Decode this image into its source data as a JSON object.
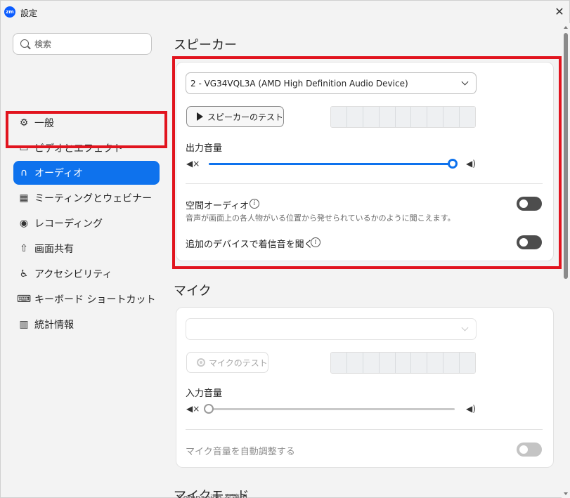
{
  "window": {
    "logo_text": "zm",
    "title": "設定",
    "close_glyph": "✕"
  },
  "sidebar": {
    "search_placeholder": "検索",
    "items": [
      {
        "label": "一般",
        "icon": "gear-icon",
        "glyph": "⚙"
      },
      {
        "label": "ビデオとエフェクト",
        "icon": "video-camera-icon",
        "glyph": "▭"
      },
      {
        "label": "オーディオ",
        "icon": "headphones-icon",
        "glyph": "∩",
        "active": true
      },
      {
        "label": "ミーティングとウェビナー",
        "icon": "meeting-icon",
        "glyph": "▦"
      },
      {
        "label": "レコーディング",
        "icon": "record-icon",
        "glyph": "◉"
      },
      {
        "label": "画面共有",
        "icon": "screen-share-icon",
        "glyph": "⇧"
      },
      {
        "label": "アクセシビリティ",
        "icon": "accessibility-icon",
        "glyph": "♿"
      },
      {
        "label": "キーボード ショートカット",
        "icon": "keyboard-icon",
        "glyph": "⌨"
      },
      {
        "label": "統計情報",
        "icon": "statistics-icon",
        "glyph": "▥"
      }
    ]
  },
  "speaker": {
    "title": "スピーカー",
    "device": "2 - VG34VQL3A (AMD High Definition Audio Device)",
    "test_button": "スピーカーのテスト",
    "meter_segments": 9,
    "volume_label": "出力音量",
    "volume_fraction": 0.99,
    "spatial_audio_label": "空間オーディオ",
    "spatial_audio_desc": "音声が画面上の各人物がいる位置から発せられているかのように聞こえます。",
    "spatial_audio_on": false,
    "ring_other_devices_label": "追加のデバイスで着信音を聞く",
    "ring_other_devices_on": false
  },
  "microphone": {
    "title": "マイク",
    "device": "",
    "test_button": "マイクのテスト",
    "meter_segments": 9,
    "volume_label": "入力音量",
    "volume_fraction": 0.0,
    "auto_adjust_label": "マイク音量を自動調整する",
    "auto_adjust_on": false
  },
  "peek": {
    "next_section_title": "マイクモード",
    "partial_text": "Companion を適用"
  },
  "colors": {
    "accent": "#0e72ed",
    "highlight_box": "#e1141e",
    "toggle_off": "#4d4d4d"
  }
}
